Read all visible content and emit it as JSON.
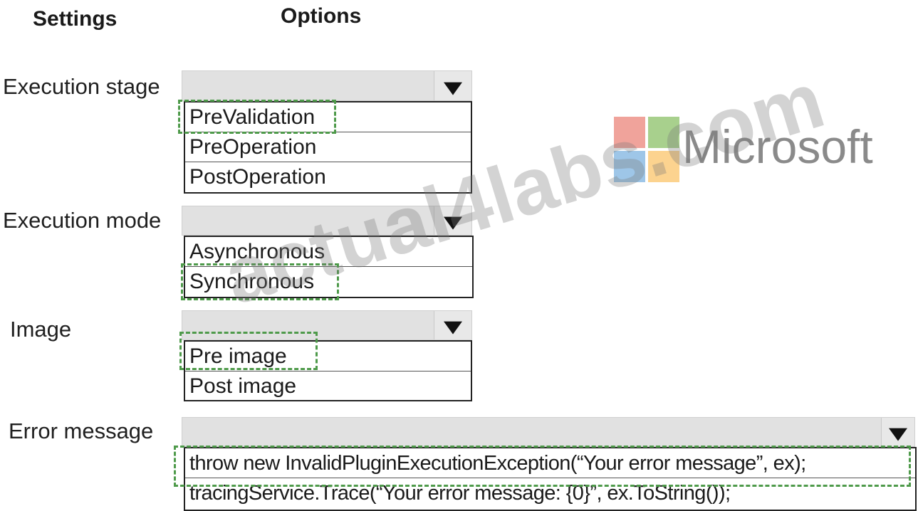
{
  "headers": {
    "settings": "Settings",
    "options": "Options"
  },
  "rows": {
    "execution_stage": {
      "label": "Execution stage",
      "options": [
        "PreValidation",
        "PreOperation",
        "PostOperation"
      ],
      "selected": "PreValidation"
    },
    "execution_mode": {
      "label": "Execution mode",
      "options": [
        "Asynchronous",
        "Synchronous"
      ],
      "selected": "Synchronous"
    },
    "image": {
      "label": "Image",
      "options": [
        "Pre image",
        "Post image"
      ],
      "selected": "Pre image"
    },
    "error_message": {
      "label": "Error message",
      "options": [
        "throw new InvalidPluginExecutionException(“Your error message”, ex);",
        "tracingService.Trace(“Your error message: {0}”, ex.ToString());"
      ],
      "selected": "throw new InvalidPluginExecutionException(“Your error message”, ex);"
    }
  },
  "branding": {
    "text": "Microsoft",
    "logo_colors": [
      "#f0a39b",
      "#a8d08d",
      "#9ec6e8",
      "#fcd38f"
    ],
    "watermark": "actual4labs.com"
  },
  "icons": {
    "dropdown_arrow": "chevron-down-icon"
  },
  "colors": {
    "selection": "#4e9a4a",
    "dropdown_bg": "#e1e1e1"
  }
}
